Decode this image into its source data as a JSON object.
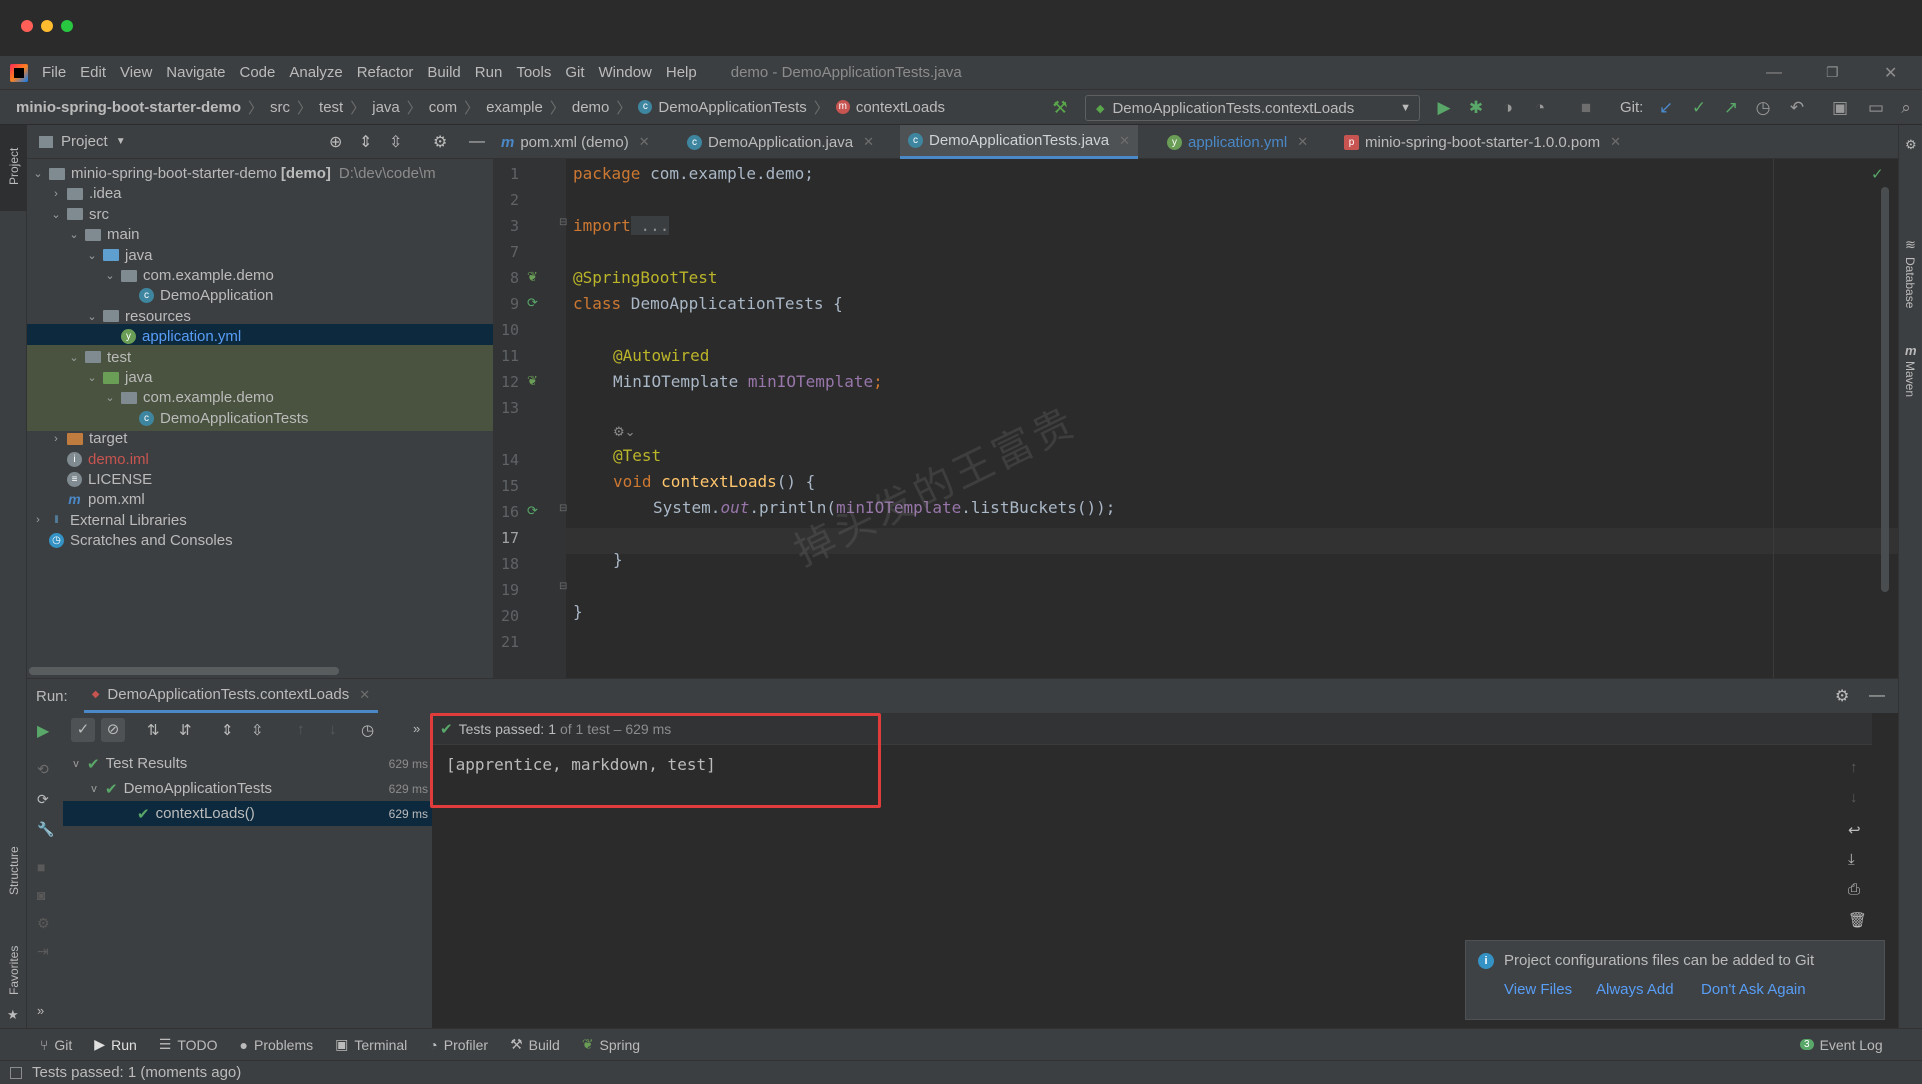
{
  "menu": [
    "File",
    "Edit",
    "View",
    "Navigate",
    "Code",
    "Analyze",
    "Refactor",
    "Build",
    "Run",
    "Tools",
    "Git",
    "Window",
    "Help"
  ],
  "window_title": "demo - DemoApplicationTests.java",
  "breadcrumbs": [
    "minio-spring-boot-starter-demo",
    "src",
    "test",
    "java",
    "com",
    "example",
    "demo",
    "DemoApplicationTests",
    "contextLoads"
  ],
  "run_config": "DemoApplicationTests.contextLoads",
  "git_label": "Git:",
  "project_panel": {
    "title": "Project",
    "tree": [
      {
        "label": "minio-spring-boot-starter-demo",
        "bold": "[demo]",
        "path": "D:\\dev\\code\\m",
        "depth": 0,
        "arrow": "v",
        "icon": "folder"
      },
      {
        "label": ".idea",
        "depth": 1,
        "arrow": ">",
        "icon": "folder"
      },
      {
        "label": "src",
        "depth": 1,
        "arrow": "v",
        "icon": "folder"
      },
      {
        "label": "main",
        "depth": 2,
        "arrow": "v",
        "icon": "folder"
      },
      {
        "label": "java",
        "depth": 3,
        "arrow": "v",
        "icon": "folder-blue"
      },
      {
        "label": "com.example.demo",
        "depth": 4,
        "arrow": "v",
        "icon": "package"
      },
      {
        "label": "DemoApplication",
        "depth": 5,
        "arrow": "",
        "icon": "class"
      },
      {
        "label": "resources",
        "depth": 3,
        "arrow": "v",
        "icon": "folder-res"
      },
      {
        "label": "application.yml",
        "depth": 4,
        "arrow": "",
        "icon": "yml",
        "selected": true
      },
      {
        "label": "test",
        "depth": 2,
        "arrow": "v",
        "icon": "folder",
        "green": true
      },
      {
        "label": "java",
        "depth": 3,
        "arrow": "v",
        "icon": "folder-green",
        "green": true
      },
      {
        "label": "com.example.demo",
        "depth": 4,
        "arrow": "v",
        "icon": "package",
        "green": true
      },
      {
        "label": "DemoApplicationTests",
        "depth": 5,
        "arrow": "",
        "icon": "class",
        "green": true
      },
      {
        "label": "target",
        "depth": 1,
        "arrow": ">",
        "icon": "folder-orange"
      },
      {
        "label": "demo.iml",
        "depth": 1,
        "arrow": "",
        "icon": "iml",
        "red": true
      },
      {
        "label": "LICENSE",
        "depth": 1,
        "arrow": "",
        "icon": "file"
      },
      {
        "label": "pom.xml",
        "depth": 1,
        "arrow": "",
        "icon": "maven"
      },
      {
        "label": "External Libraries",
        "depth": 0,
        "arrow": ">",
        "icon": "libs"
      },
      {
        "label": "Scratches and Consoles",
        "depth": 0,
        "arrow": "",
        "icon": "scratch"
      }
    ]
  },
  "editor_tabs": [
    {
      "label": "pom.xml (demo)",
      "icon": "m"
    },
    {
      "label": "DemoApplication.java",
      "icon": "c"
    },
    {
      "label": "DemoApplicationTests.java",
      "icon": "c",
      "active": true
    },
    {
      "label": "application.yml",
      "icon": "y"
    },
    {
      "label": "minio-spring-boot-starter-1.0.0.pom",
      "icon": "p"
    }
  ],
  "code": {
    "line_numbers": [
      "1",
      "2",
      "3",
      "7",
      "8",
      "9",
      "10",
      "11",
      "12",
      "13",
      "",
      "14",
      "15",
      "16",
      "17",
      "18",
      "19",
      "20",
      "21"
    ],
    "l1_kw": "package",
    "l1_rest": " com.example.demo;",
    "l3_kw": "import",
    "l3_rest": " ...",
    "l8": "@SpringBootTest",
    "l9_kw": "class",
    "l9_rest": " DemoApplicationTests {",
    "l11": "@Autowired",
    "l12_type": "MinIOTemplate",
    "l12_field": "minIOTemplate",
    "l12_end": ";",
    "l14": "@Test",
    "l15_kw": "void",
    "l15_fn": "contextLoads",
    "l15_rest": "() {",
    "l16_a": "System.",
    "l16_out": "out",
    "l16_b": ".println(",
    "l16_field": "minIOTemplate",
    "l16_c": ".listBuckets());",
    "l18": "}",
    "l20": "}"
  },
  "watermark": "掉头发的王富贵",
  "run": {
    "label": "Run:",
    "tab": "DemoApplicationTests.contextLoads",
    "status_prefix": "Tests passed:",
    "status_count": "1",
    "status_suffix": "of 1 test – 629 ms",
    "output": "[apprentice, markdown, test]",
    "results": [
      {
        "label": "Test Results",
        "time": "629 ms"
      },
      {
        "label": "DemoApplicationTests",
        "time": "629 ms"
      },
      {
        "label": "contextLoads()",
        "time": "629 ms"
      }
    ]
  },
  "notification": {
    "message": "Project configurations files can be added to Git",
    "actions": [
      "View Files",
      "Always Add",
      "Don't Ask Again"
    ]
  },
  "bottom_tools": [
    "Git",
    "Run",
    "TODO",
    "Problems",
    "Terminal",
    "Profiler",
    "Build",
    "Spring"
  ],
  "event_log": "Event Log",
  "event_log_count": "3",
  "status_text": "Tests passed: 1 (moments ago)",
  "side_labels": {
    "project": "Project",
    "structure": "Structure",
    "favorites": "Favorites",
    "database": "Database",
    "maven": "Maven"
  },
  "colors": {
    "accent": "#4a88c7",
    "pass": "#5aa64b",
    "highlight_box": "#e03c3c"
  }
}
